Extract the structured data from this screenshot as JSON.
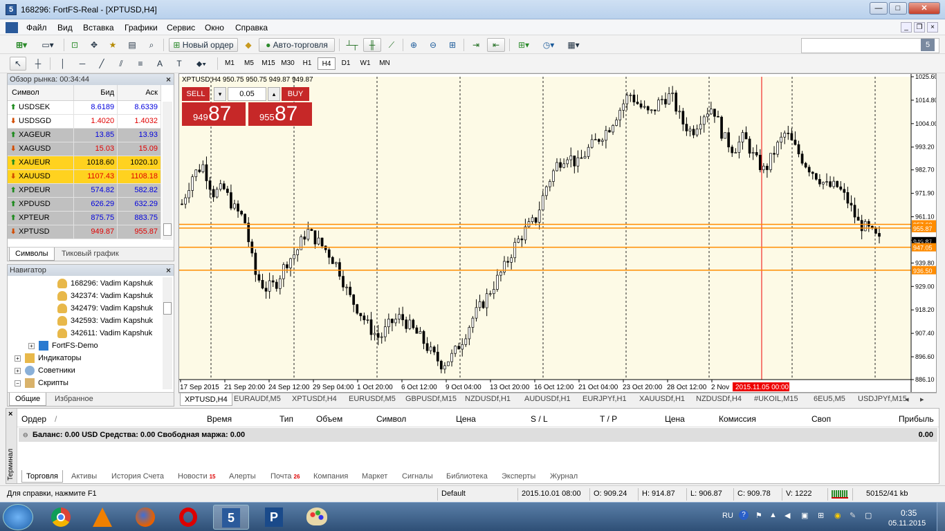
{
  "window": {
    "title": "168296: FortFS-Real - [XPTUSD,H4]",
    "app_icon": "5"
  },
  "menu": [
    "Файл",
    "Вид",
    "Вставка",
    "Графики",
    "Сервис",
    "Окно",
    "Справка"
  ],
  "toolbar": {
    "new_order": "Новый ордер",
    "auto_trading": "Авто-торговля",
    "timeframes": [
      "M1",
      "M5",
      "M15",
      "M30",
      "H1",
      "H4",
      "D1",
      "W1",
      "MN"
    ],
    "active_timeframe": "H4"
  },
  "market_watch": {
    "title": "Обзор рынка: 00:34:44",
    "columns": [
      "Символ",
      "Бид",
      "Аск"
    ],
    "rows": [
      {
        "symbol": "USDSEK",
        "bid": "8.6189",
        "ask": "8.6339",
        "dir": "up",
        "color": "#0000dd",
        "bg": "#ffffff"
      },
      {
        "symbol": "USDSGD",
        "bid": "1.4020",
        "ask": "1.4032",
        "dir": "dn",
        "color": "#e00000",
        "bg": "#ffffff"
      },
      {
        "symbol": "XAGEUR",
        "bid": "13.85",
        "ask": "13.93",
        "dir": "up",
        "color": "#0000dd",
        "bg": "#c0c0c0"
      },
      {
        "symbol": "XAGUSD",
        "bid": "15.03",
        "ask": "15.09",
        "dir": "dn",
        "color": "#e00000",
        "bg": "#c0c0c0"
      },
      {
        "symbol": "XAUEUR",
        "bid": "1018.60",
        "ask": "1020.10",
        "dir": "up",
        "color": "#000000",
        "bg": "#ffd21f"
      },
      {
        "symbol": "XAUUSD",
        "bid": "1107.43",
        "ask": "1108.18",
        "dir": "dn",
        "color": "#e00000",
        "bg": "#ffd21f"
      },
      {
        "symbol": "XPDEUR",
        "bid": "574.82",
        "ask": "582.82",
        "dir": "up",
        "color": "#0000dd",
        "bg": "#c0c0c0"
      },
      {
        "symbol": "XPDUSD",
        "bid": "626.29",
        "ask": "632.29",
        "dir": "up",
        "color": "#0000dd",
        "bg": "#c0c0c0"
      },
      {
        "symbol": "XPTEUR",
        "bid": "875.75",
        "ask": "883.75",
        "dir": "up",
        "color": "#0000dd",
        "bg": "#c0c0c0"
      },
      {
        "symbol": "XPTUSD",
        "bid": "949.87",
        "ask": "955.87",
        "dir": "dn",
        "color": "#e00000",
        "bg": "#c0c0c0"
      }
    ],
    "tabs": [
      "Символы",
      "Тиковый график"
    ]
  },
  "navigator": {
    "title": "Навигатор",
    "accounts": [
      "168296: Vadim Kapshuk",
      "342374: Vadim Kapshuk",
      "342479: Vadim Kapshuk",
      "342593: Vadim Kapshuk",
      "342611: Vadim Kapshuk"
    ],
    "server": "FortFS-Demo",
    "groups": [
      "Индикаторы",
      "Советники",
      "Скрипты"
    ],
    "tabs": [
      "Общие",
      "Избранное"
    ]
  },
  "chart": {
    "header": "XPTUSD,H4  950.75 950.75 949.87 949.87",
    "sell_label": "SELL",
    "buy_label": "BUY",
    "lot": "0.05",
    "sell_small": "949",
    "sell_big": "87",
    "buy_small": "955",
    "buy_big": "87",
    "price_ticks": [
      "1025.60",
      "1014.80",
      "1004.00",
      "993.20",
      "982.70",
      "971.90",
      "961.10",
      "950.30",
      "939.80",
      "929.00",
      "918.20",
      "907.40",
      "896.60",
      "886.10"
    ],
    "date_ticks": [
      "17 Sep 2015",
      "21 Sep 20:00",
      "24 Sep 12:00",
      "29 Sep 04:00",
      "1 Oct 20:00",
      "6 Oct 12:00",
      "9 Oct 04:00",
      "13 Oct 20:00",
      "16 Oct 12:00",
      "21 Oct 04:00",
      "23 Oct 20:00",
      "28 Oct 12:00",
      "2 Nov"
    ],
    "current_time_label": "2015.11.05 00:00",
    "levels": [
      {
        "price": "957.60",
        "color": "#ff8c00"
      },
      {
        "price": "955.87",
        "color": "#ff8c00"
      },
      {
        "price": "949.87",
        "color": "#000000"
      },
      {
        "price": "947.05",
        "color": "#ff8c00"
      },
      {
        "price": "936.50",
        "color": "#ff8c00"
      }
    ]
  },
  "chart_data": {
    "type": "candlestick",
    "title": "XPTUSD,H4",
    "ylim": [
      886.1,
      1025.6
    ],
    "x_labels": [
      "17 Sep 2015",
      "21 Sep 20:00",
      "24 Sep 12:00",
      "29 Sep 04:00",
      "1 Oct 20:00",
      "6 Oct 12:00",
      "9 Oct 04:00",
      "13 Oct 20:00",
      "16 Oct 12:00",
      "21 Oct 04:00",
      "23 Oct 20:00",
      "28 Oct 12:00",
      "2 Nov"
    ],
    "close_path": [
      967,
      980,
      985,
      972,
      974,
      965,
      960,
      935,
      928,
      930,
      940,
      945,
      955,
      950,
      945,
      938,
      925,
      918,
      910,
      905,
      912,
      915,
      910,
      905,
      898,
      893,
      897,
      905,
      915,
      922,
      930,
      938,
      948,
      955,
      960,
      975,
      985,
      990,
      985,
      992,
      997,
      1002,
      1010,
      1018,
      1012,
      1008,
      1015,
      1017,
      1005,
      1000,
      1008,
      1012,
      998,
      992,
      998,
      988,
      982,
      992,
      1000,
      992,
      985,
      980,
      975,
      975,
      968,
      958,
      955,
      950
    ]
  },
  "chart_tabs": [
    "XPTUSD,H4",
    "EURAUDf,M5",
    "XPTUSDf,H4",
    "EURUSDf,M5",
    "GBPUSDf,M15",
    "NZDUSDf,H1",
    "AUDUSDf,H1",
    "EURJPYf,H1",
    "XAUUSDf,H1",
    "NZDUSDf,H4",
    "#UKOIL,M15",
    "6EU5,M5",
    "USDJPYf,M15"
  ],
  "terminal": {
    "side_label": "Терминал",
    "columns": [
      "Ордер",
      "/",
      "Время",
      "Тип",
      "Объем",
      "Символ",
      "Цена",
      "S / L",
      "T / P",
      "Цена",
      "Комиссия",
      "Своп",
      "Прибыль"
    ],
    "balance_text": "Баланс: 0.00 USD  Средства: 0.00  Свободная маржа: 0.00",
    "profit": "0.00",
    "tabs": [
      {
        "label": "Торговля",
        "badge": ""
      },
      {
        "label": "Активы",
        "badge": ""
      },
      {
        "label": "История Счета",
        "badge": ""
      },
      {
        "label": "Новости",
        "badge": "15"
      },
      {
        "label": "Алерты",
        "badge": ""
      },
      {
        "label": "Почта",
        "badge": "26"
      },
      {
        "label": "Компания",
        "badge": ""
      },
      {
        "label": "Маркет",
        "badge": ""
      },
      {
        "label": "Сигналы",
        "badge": ""
      },
      {
        "label": "Библиотека",
        "badge": ""
      },
      {
        "label": "Эксперты",
        "badge": ""
      },
      {
        "label": "Журнал",
        "badge": ""
      }
    ]
  },
  "statusbar": {
    "help": "Для справки, нажмите F1",
    "profile": "Default",
    "datetime": "2015.10.01 08:00",
    "open": "O: 909.24",
    "high": "H: 914.87",
    "low": "L: 906.87",
    "close": "C: 909.78",
    "volume": "V: 1222",
    "traffic": "50152/41 kb"
  },
  "taskbar": {
    "lang": "RU",
    "time": "0:35",
    "date": "05.11.2015"
  }
}
